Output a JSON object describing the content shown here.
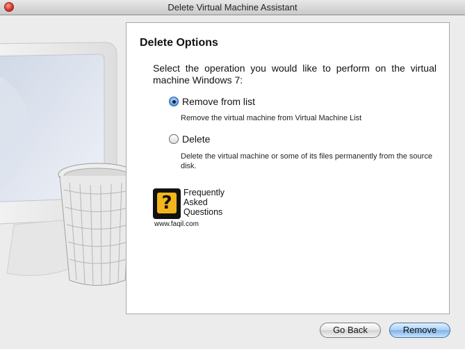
{
  "window": {
    "title": "Delete Virtual Machine Assistant"
  },
  "panel": {
    "heading": "Delete Options",
    "prompt": "Select the operation you would like to perform on the virtual machine Windows 7:",
    "options": [
      {
        "label": "Remove from list",
        "description": "Remove the virtual machine from Virtual Machine List",
        "selected": true
      },
      {
        "label": "Delete",
        "description": "Delete the virtual machine or some of its files permanently from the source disk.",
        "selected": false
      }
    ]
  },
  "watermark": {
    "badge_glyph": "?",
    "line1": "Frequently",
    "line2": "Asked",
    "line3": "Questions",
    "url": "www.faqil.com"
  },
  "buttons": {
    "back_label": "Go Back",
    "remove_label": "Remove"
  },
  "colors": {
    "accent": "#5b9be0",
    "close": "#d8302a",
    "faq_badge": "#f2b51c"
  }
}
